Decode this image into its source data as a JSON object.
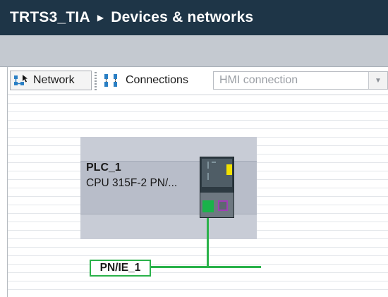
{
  "titlebar": {
    "project": "TRTS3_TIA",
    "separator": "▶",
    "section": "Devices & networks"
  },
  "toolbar": {
    "network_label": "Network",
    "connections_label": "Connections",
    "connection_type": "HMI connection",
    "dropdown_arrow": "▼"
  },
  "device": {
    "name": "PLC_1",
    "type": "CPU 315F-2 PN/..."
  },
  "subnet": {
    "name": "PN/IE_1"
  },
  "colors": {
    "titlebar_bg": "#1e3547",
    "network_line": "#2ab24a",
    "led": "#f2e100",
    "port_purple": "#a03fb6"
  }
}
